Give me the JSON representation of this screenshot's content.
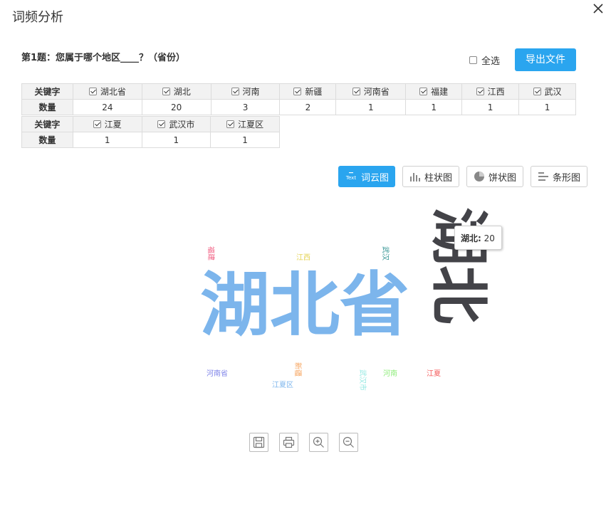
{
  "dialog": {
    "title": "词频分析"
  },
  "question": {
    "text": "第1题：您属于哪个地区____？（省份）"
  },
  "controls": {
    "select_all_label": "全选",
    "select_all_checked": false,
    "export_label": "导出文件"
  },
  "table": {
    "keyword_header": "关键字",
    "count_header": "数量",
    "row1": [
      {
        "keyword": "湖北省",
        "count": "24"
      },
      {
        "keyword": "湖北",
        "count": "20"
      },
      {
        "keyword": "河南",
        "count": "3"
      },
      {
        "keyword": "新疆",
        "count": "2"
      },
      {
        "keyword": "河南省",
        "count": "1"
      },
      {
        "keyword": "福建",
        "count": "1"
      },
      {
        "keyword": "江西",
        "count": "1"
      },
      {
        "keyword": "武汉",
        "count": "1"
      }
    ],
    "row2": [
      {
        "keyword": "江夏",
        "count": "1"
      },
      {
        "keyword": "武汉市",
        "count": "1"
      },
      {
        "keyword": "江夏区",
        "count": "1"
      }
    ]
  },
  "chart_tabs": {
    "wordcloud": "词云图",
    "wordcloud_icon_text": "Text",
    "bar": "柱状图",
    "pie": "饼状图",
    "hbar": "条形图",
    "active": "wordcloud"
  },
  "chart_data": {
    "type": "wordcloud",
    "words": [
      {
        "text": "湖北省",
        "value": 24,
        "color": "#7cb5ec"
      },
      {
        "text": "湖北",
        "value": 20,
        "color": "#434348"
      },
      {
        "text": "河南",
        "value": 3,
        "color": "#90ed7d"
      },
      {
        "text": "新疆",
        "value": 2,
        "color": "#f7a35c"
      },
      {
        "text": "河南省",
        "value": 1,
        "color": "#8085e9"
      },
      {
        "text": "福建",
        "value": 1,
        "color": "#f15c80"
      },
      {
        "text": "江西",
        "value": 1,
        "color": "#e4d354"
      },
      {
        "text": "武汉",
        "value": 1,
        "color": "#2b908f"
      },
      {
        "text": "江夏",
        "value": 1,
        "color": "#f45b5b"
      },
      {
        "text": "武汉市",
        "value": 1,
        "color": "#91e8e1"
      },
      {
        "text": "江夏区",
        "value": 1,
        "color": "#7cb5ec"
      }
    ],
    "tooltip": {
      "label": "湖北:",
      "value": "20"
    }
  },
  "toolbar": {
    "icons": [
      "save-icon",
      "print-icon",
      "zoom-in-icon",
      "zoom-out-icon"
    ]
  }
}
